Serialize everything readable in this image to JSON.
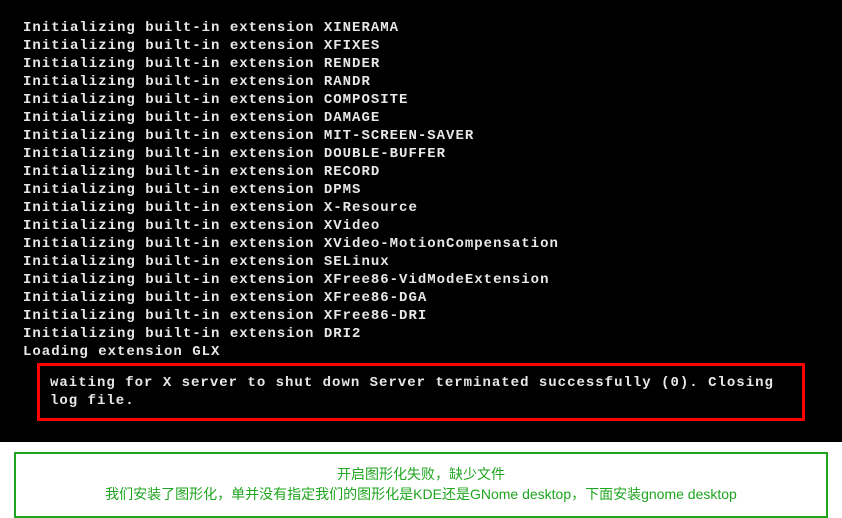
{
  "terminal": {
    "extensions": [
      "XINERAMA",
      "XFIXES",
      "RENDER",
      "RANDR",
      "COMPOSITE",
      "DAMAGE",
      "MIT-SCREEN-SAVER",
      "DOUBLE-BUFFER",
      "RECORD",
      "DPMS",
      "X-Resource",
      "XVideo",
      "XVideo-MotionCompensation",
      "SELinux",
      "XFree86-VidModeExtension",
      "XFree86-DGA",
      "XFree86-DRI",
      "DRI2"
    ],
    "loading_line": "Loading extension GLX",
    "prefix": "Initializing built-in extension ",
    "error_box": "waiting for X server to shut down Server terminated successfully (0). Closing log file."
  },
  "note": {
    "line1": "开启图形化失败，缺少文件",
    "line2": "我们安装了图形化，单并没有指定我们的图形化是KDE还是GNome desktop，下面安装gnome desktop"
  }
}
